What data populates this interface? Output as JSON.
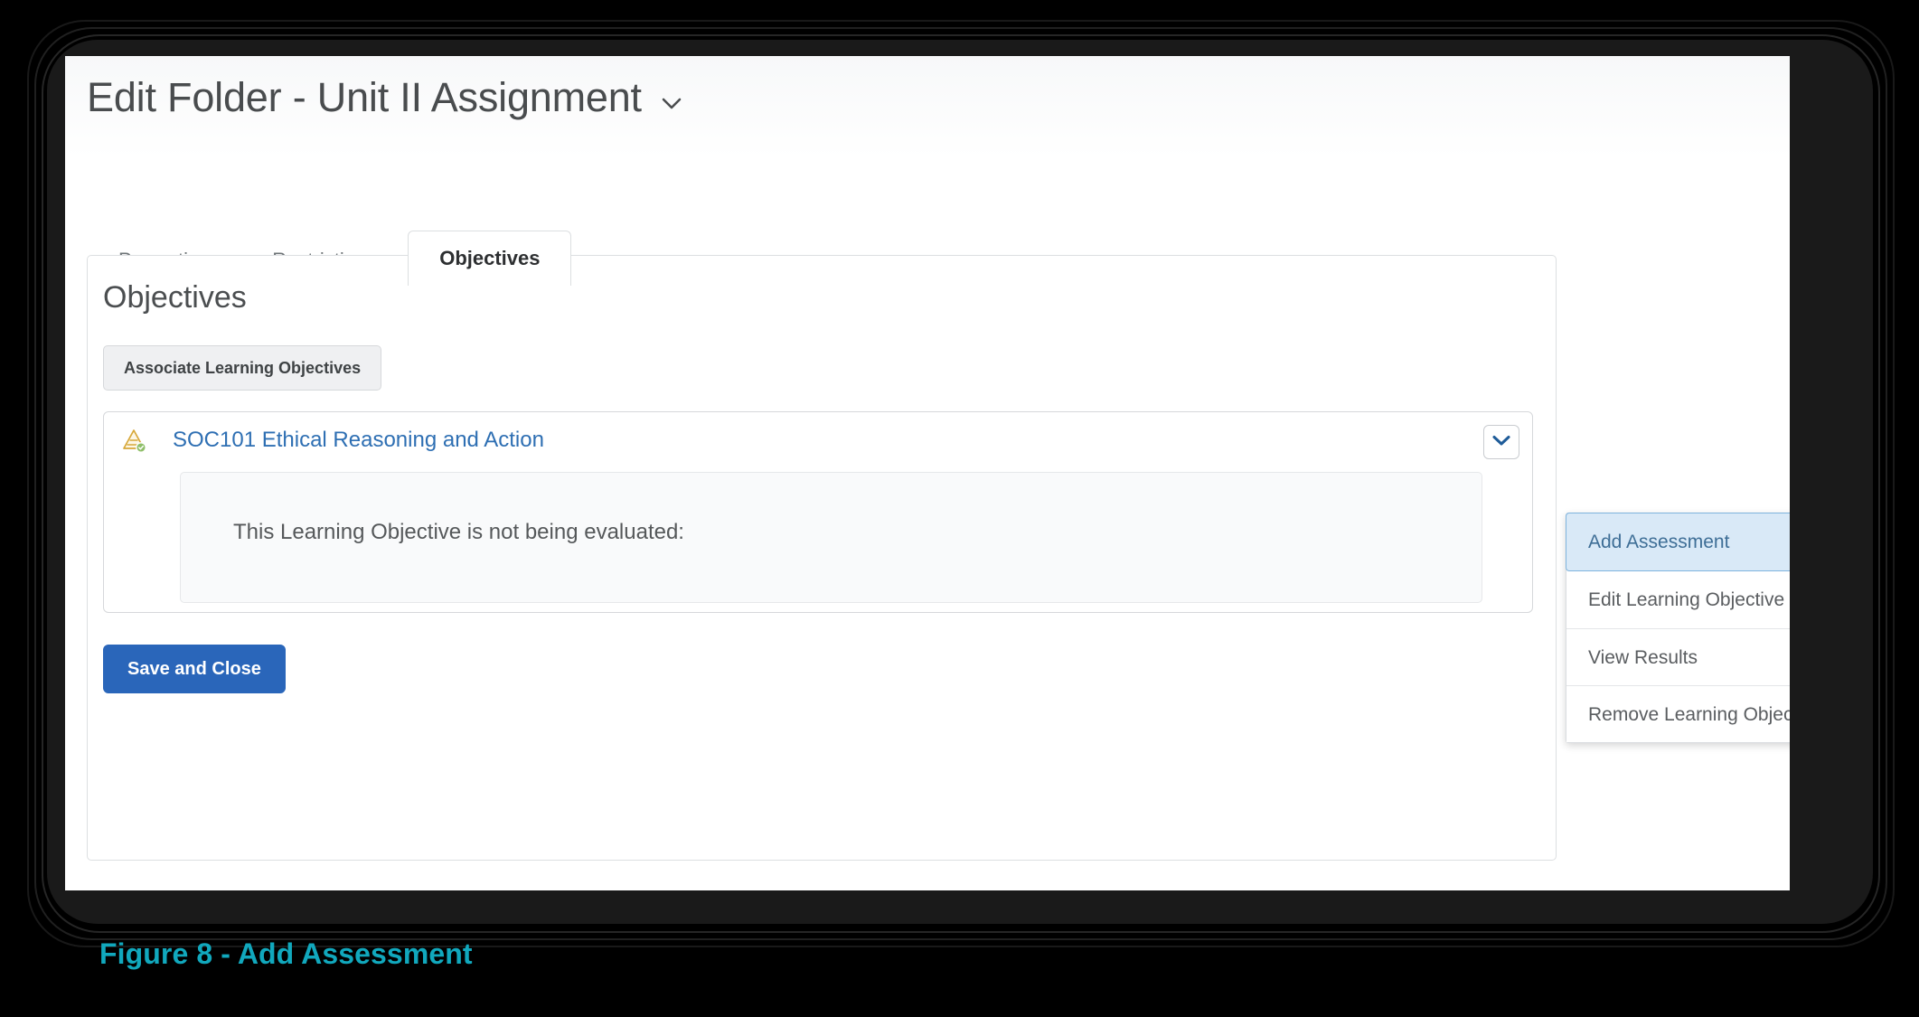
{
  "header": {
    "title": "Edit Folder - Unit II Assignment",
    "title_chevron_icon": "chevron-down-icon"
  },
  "tabs": [
    {
      "label": "Properties",
      "active": false
    },
    {
      "label": "Restrictions",
      "active": false
    },
    {
      "label": "Objectives",
      "active": true
    }
  ],
  "panel": {
    "heading": "Objectives",
    "associate_button_label": "Associate Learning Objectives"
  },
  "objective": {
    "icon": "learning-objective-pyramid-icon",
    "link_label": "SOC101 Ethical Reasoning and Action",
    "chevron_icon": "chevron-down-icon",
    "status_text": "This Learning Objective is not being evaluated:"
  },
  "dropdown": {
    "items": [
      {
        "label": "Add Assessment",
        "highlighted": true
      },
      {
        "label": "Edit Learning Objective",
        "highlighted": false
      },
      {
        "label": "View Results",
        "highlighted": false
      },
      {
        "label": "Remove Learning Objective",
        "highlighted": false
      }
    ]
  },
  "footer": {
    "save_button_label": "Save and Close"
  },
  "figure": {
    "caption": "Figure 8 - Add Assessment"
  },
  "colors": {
    "primary_button": "#2a66ba",
    "link": "#2e6fb3",
    "caption": "#11a8bd",
    "menu_highlight_bg": "#d9e9f7",
    "menu_highlight_border": "#7fb4de"
  }
}
